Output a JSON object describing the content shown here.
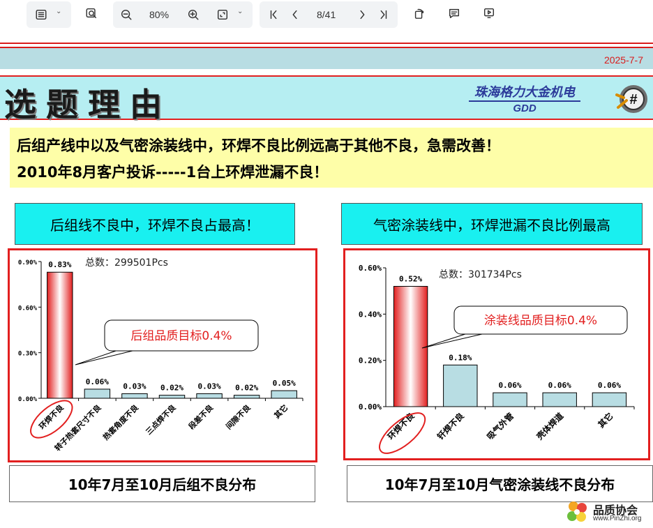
{
  "toolbar": {
    "zoom": "80%",
    "page_indicator": "8/41",
    "icons": [
      "sidebar-icon",
      "search-icon",
      "zoom-out-icon",
      "zoom-in-icon",
      "fit-page-icon",
      "first-page-icon",
      "prev-page-icon",
      "next-page-icon",
      "last-page-icon",
      "rotate-icon",
      "comment-icon",
      "present-icon"
    ]
  },
  "slide": {
    "date": "2025-7-7",
    "title": "选题理由",
    "company": "珠海格力大金机电",
    "company_short": "GDD",
    "logo_text": "#",
    "reason_line1": "后组产线中以及气密涂装线中，环焊不良比例远高于其他不良，急需改善！",
    "reason_line2": "2010年8月客户投诉-----1台上环焊泄漏不良！",
    "left_heading": "后组线不良中，环焊不良占最高！",
    "right_heading": "气密涂装线中，环焊泄漏不良比例最高",
    "left_caption": "10年7月至10月后组不良分布",
    "right_caption": "10年7月至10月气密涂装线不良分布",
    "watermark_cn": "品质协会",
    "watermark_url": "www.PinZhi.org"
  },
  "colors": {
    "accent_red": "#e21f1f",
    "bar_fill": "#b8dde3",
    "title_band": "#b6eef2",
    "reason_bg": "#fefea8",
    "heading_bg": "#19f0f0"
  },
  "chart_data": [
    {
      "type": "bar",
      "total_label": "总数：299501Pcs",
      "categories": [
        "环焊不良",
        "转子热套尺寸不良",
        "热套角度不良",
        "三点焊不良",
        "段差不良",
        "间隙不良",
        "其它"
      ],
      "values": [
        0.83,
        0.06,
        0.03,
        0.02,
        0.03,
        0.02,
        0.05
      ],
      "value_labels": [
        "0.83%",
        "0.06%",
        "0.03%",
        "0.02%",
        "0.03%",
        "0.02%",
        "0.05%"
      ],
      "y_ticks": [
        "0.00%",
        "0.30%",
        "0.60%",
        "0.90%"
      ],
      "ylim": [
        0,
        0.9
      ],
      "highlight_index": 0,
      "callout": "后组品质目标0.4%",
      "grid": false
    },
    {
      "type": "bar",
      "total_label": "总数：301734Pcs",
      "categories": [
        "环焊不良",
        "钎焊不良",
        "吸气外管",
        "壳体焊道",
        "其它"
      ],
      "values": [
        0.52,
        0.18,
        0.06,
        0.06,
        0.06
      ],
      "value_labels": [
        "0.52%",
        "0.18%",
        "0.06%",
        "0.06%",
        "0.06%"
      ],
      "y_ticks": [
        "0.00%",
        "0.20%",
        "0.40%",
        "0.60%"
      ],
      "ylim": [
        0,
        0.6
      ],
      "highlight_index": 0,
      "callout": "涂装线品质目标0.4%",
      "grid": false
    }
  ]
}
